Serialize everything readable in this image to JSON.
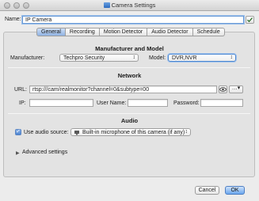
{
  "window": {
    "title": "Camera Settings"
  },
  "name": {
    "label": "Name:",
    "value": "IP Camera"
  },
  "tabs": [
    {
      "label": "General",
      "active": true
    },
    {
      "label": "Recording",
      "active": false
    },
    {
      "label": "Motion Detector",
      "active": false
    },
    {
      "label": "Audio Detector",
      "active": false
    },
    {
      "label": "Schedule",
      "active": false
    }
  ],
  "manufacturer_model": {
    "heading": "Manufacturer and Model",
    "manufacturer_label": "Manufacturer:",
    "manufacturer_value": "Techpro Security",
    "model_label": "Model:",
    "model_value": "DVR,NVR"
  },
  "network": {
    "heading": "Network",
    "url_label": "URL:",
    "url_value": "rtsp:///cam/realmonitor?channel=0&subtype=00",
    "ip_label": "IP:",
    "ip_value": "",
    "user_label": "User Name:",
    "user_value": "",
    "password_label": "Password:",
    "password_value": ""
  },
  "audio": {
    "heading": "Audio",
    "use_label": "Use audio source:",
    "use_checked": true,
    "source_value": "Built-in microphone of this camera (if any)"
  },
  "advanced": {
    "label": "Advanced settings"
  },
  "buttons": {
    "cancel": "Cancel",
    "ok": "OK"
  },
  "icons": {
    "window_controls": "traffic-light-icons",
    "name_picker": "checkmark-list-icon",
    "url_eye": "eye-icon",
    "url_more": "ellipsis-icon"
  }
}
